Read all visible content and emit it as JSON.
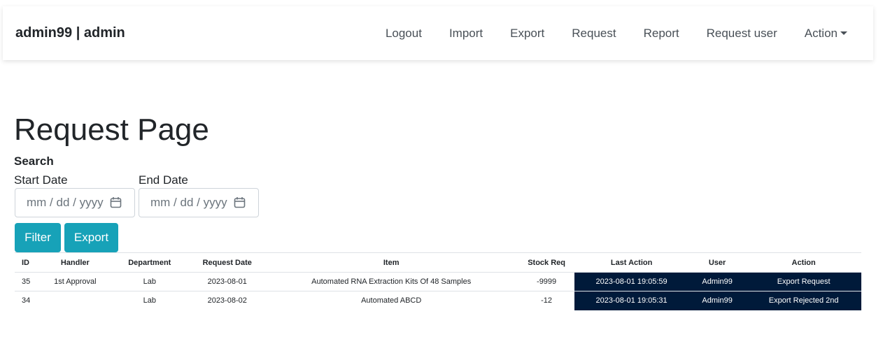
{
  "navbar": {
    "brand": "admin99 | admin",
    "links": [
      "Logout",
      "Import",
      "Export",
      "Request",
      "Report",
      "Request user",
      "Action"
    ]
  },
  "page": {
    "title": "Request Page",
    "search_label": "Search",
    "start_date_label": "Start Date",
    "end_date_label": "End Date",
    "date_placeholder": "mm / dd / yyyy",
    "filter_button": "Filter",
    "export_button": "Export"
  },
  "table": {
    "headers": [
      "ID",
      "Handler",
      "Department",
      "Request Date",
      "Item",
      "Stock Req",
      "Last Action",
      "User",
      "Action"
    ],
    "rows": [
      [
        "35",
        "1st Approval",
        "Lab",
        "2023-08-01",
        "Automated RNA Extraction Kits Of 48 Samples",
        "-9999",
        "2023-08-01 19:05:59",
        "Admin99",
        "Export Request"
      ],
      [
        "34",
        "",
        "Lab",
        "2023-08-02",
        "Automated ABCD",
        "-12",
        "2023-08-01 19:05:31",
        "Admin99",
        "Export Rejected 2nd"
      ]
    ]
  },
  "colors": {
    "button_bg": "#17a2b8",
    "highlight_cell_bg": "#001a3a"
  }
}
